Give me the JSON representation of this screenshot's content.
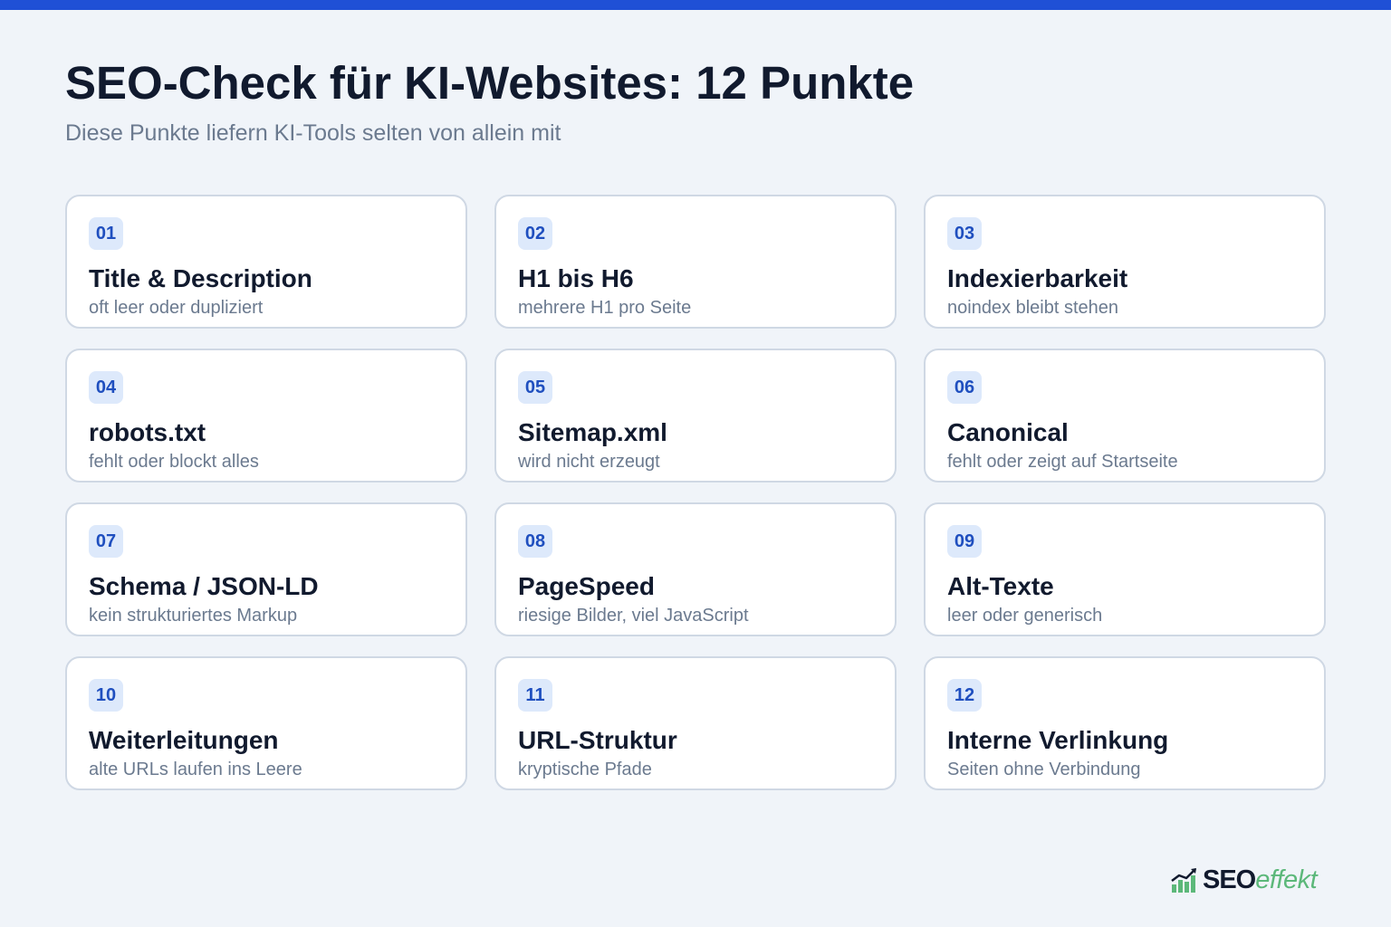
{
  "header": {
    "title": "SEO-Check für KI-Websites: 12 Punkte",
    "subtitle": "Diese Punkte liefern KI-Tools selten von allein mit"
  },
  "cards": [
    {
      "number": "01",
      "title": "Title & Description",
      "description": "oft leer oder dupliziert"
    },
    {
      "number": "02",
      "title": "H1 bis H6",
      "description": "mehrere H1 pro Seite"
    },
    {
      "number": "03",
      "title": "Indexierbarkeit",
      "description": "noindex bleibt stehen"
    },
    {
      "number": "04",
      "title": "robots.txt",
      "description": "fehlt oder blockt alles"
    },
    {
      "number": "05",
      "title": "Sitemap.xml",
      "description": "wird nicht erzeugt"
    },
    {
      "number": "06",
      "title": "Canonical",
      "description": "fehlt oder zeigt auf Startseite"
    },
    {
      "number": "07",
      "title": "Schema / JSON-LD",
      "description": "kein strukturiertes Markup"
    },
    {
      "number": "08",
      "title": "PageSpeed",
      "description": "riesige Bilder, viel JavaScript"
    },
    {
      "number": "09",
      "title": "Alt-Texte",
      "description": "leer oder generisch"
    },
    {
      "number": "10",
      "title": "Weiterleitungen",
      "description": "alte URLs laufen ins Leere"
    },
    {
      "number": "11",
      "title": "URL-Struktur",
      "description": "kryptische Pfade"
    },
    {
      "number": "12",
      "title": "Interne Verlinkung",
      "description": "Seiten ohne Verbindung"
    }
  ],
  "logo": {
    "part1": "SEO",
    "part2": "effekt",
    "icon": "bar-chart-trend-icon"
  },
  "colors": {
    "accent": "#1f50d6",
    "badge_bg": "#dde9fb",
    "badge_text": "#1f4fbf",
    "logo_green": "#5cb87a"
  }
}
